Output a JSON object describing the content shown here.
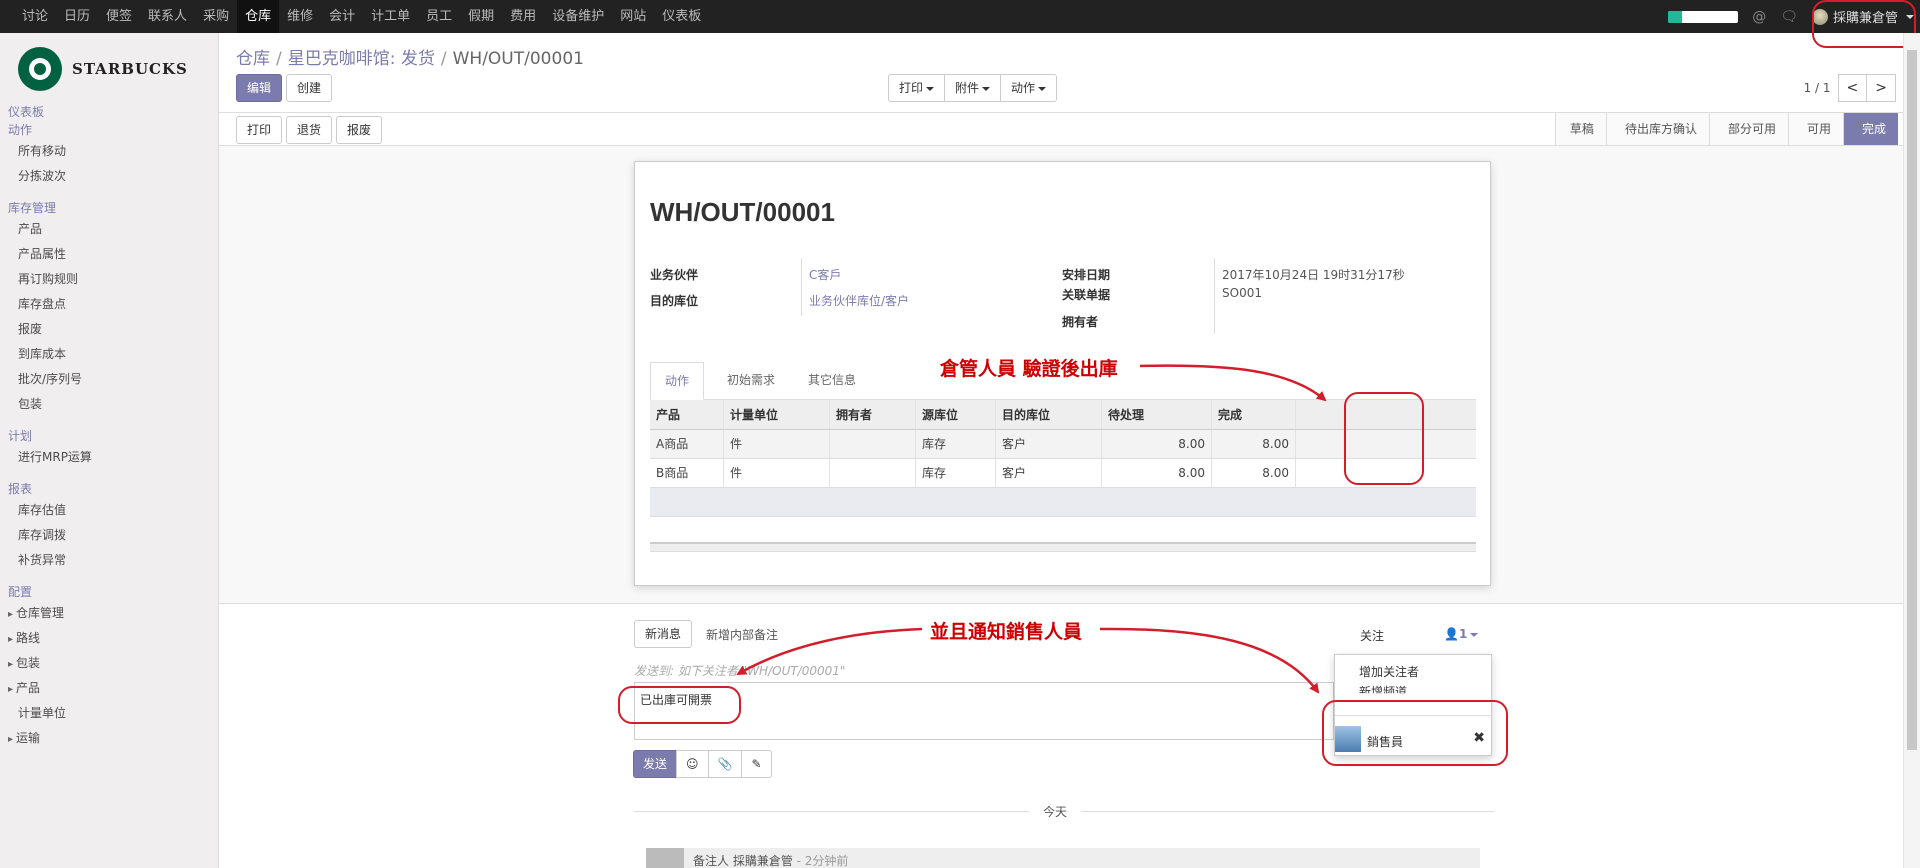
{
  "topbar": {
    "menu": [
      "讨论",
      "日历",
      "便签",
      "联系人",
      "采购",
      "仓库",
      "维修",
      "会计",
      "计工单",
      "员工",
      "假期",
      "费用",
      "设备维护",
      "网站",
      "仪表板"
    ],
    "active_index": 5,
    "progress": 0.2,
    "user": "採購兼倉管"
  },
  "sidebar": {
    "logo_text": "STARBUCKS",
    "dashboard": "仪表板",
    "actions_header": "动作",
    "actions": [
      "所有移动",
      "分拣波次"
    ],
    "inventory_header": "库存管理",
    "inventory": [
      "产品",
      "产品属性",
      "再订购规则",
      "库存盘点",
      "报废",
      "到库成本",
      "批次/序列号",
      "包装"
    ],
    "plan_header": "计划",
    "plan": [
      "进行MRP运算"
    ],
    "report_header": "报表",
    "reports": [
      "库存估值",
      "库存调拨",
      "补货异常"
    ],
    "config_header": "配置",
    "config": [
      "仓库管理",
      "路线",
      "包装",
      "产品",
      "计量单位",
      "运输"
    ]
  },
  "breadcrumb": {
    "root": "仓库",
    "parent": "星巴克咖啡馆: 发货",
    "current": "WH/OUT/00001"
  },
  "buttons": {
    "edit": "编辑",
    "create": "创建",
    "print": "打印",
    "attach": "附件",
    "action": "动作"
  },
  "pager": {
    "count": "1 / 1",
    "prev": "<",
    "next": ">"
  },
  "status_actions": [
    "打印",
    "退货",
    "报废"
  ],
  "stages": [
    "草稿",
    "待出库方确认",
    "部分可用",
    "可用",
    "完成"
  ],
  "active_stage": 4,
  "record": {
    "name": "WH/OUT/00001",
    "partner_label": "业务伙伴",
    "partner": "C客戶",
    "dest_label": "目的库位",
    "dest": "业务伙伴库位/客户",
    "date_label": "安排日期",
    "date": "2017年10月24日 19时31分17秒",
    "origin_label": "关联单据",
    "origin": "SO001",
    "owner_label": "拥有者"
  },
  "tabs": [
    "动作",
    "初始需求",
    "其它信息"
  ],
  "grid": {
    "headers": [
      "产品",
      "计量单位",
      "拥有者",
      "源库位",
      "目的库位",
      "待处理",
      "完成"
    ],
    "rows": [
      [
        "A商品",
        "件",
        "",
        "库存",
        "客户",
        "8.00",
        "8.00"
      ],
      [
        "B商品",
        "件",
        "",
        "库存",
        "客户",
        "8.00",
        "8.00"
      ]
    ]
  },
  "chatter": {
    "new_message": "新消息",
    "log_note": "新增内部备注",
    "follow": "关注",
    "followers": "1",
    "hint": "发送到: 如下关注者 \"WH/OUT/00001\"",
    "composer_text": "已出庫可開票",
    "send": "发送",
    "today": "今天",
    "message_author": "备注人 採購兼倉管",
    "message_time": " - 2分钟前"
  },
  "followers_menu": {
    "add_follower": "增加关注者",
    "add_channel": "新增频道",
    "follower_name": "銷售員"
  },
  "annotations": {
    "top": "倉管人員 驗證後出庫",
    "bottom": "並且通知銷售人員"
  },
  "colors": {
    "accent": "#7c7bad",
    "annotation": "#d21e2a"
  }
}
